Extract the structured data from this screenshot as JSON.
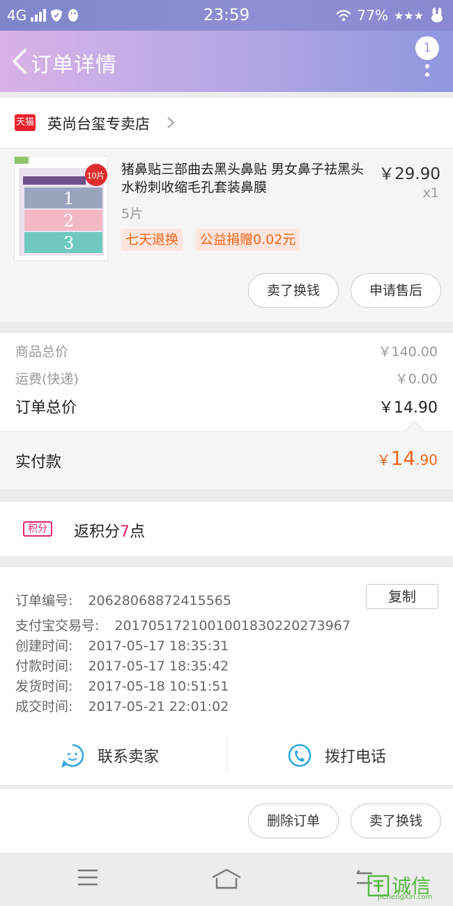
{
  "status_bar": {
    "network": "4G",
    "time": "23:59",
    "battery": "77%"
  },
  "header": {
    "title": "订单详情",
    "badge": "1"
  },
  "shop": {
    "platform_badge": "天猫",
    "name": "英尚台玺专卖店"
  },
  "product": {
    "name": "猪鼻贴三部曲去黑头鼻贴 男女鼻子祛黑头水粉刺收缩毛孔套装鼻膜",
    "price": "￥29.90",
    "quantity": "x1",
    "spec": "5片",
    "tags": [
      "七天退换",
      "公益捐赠0.02元"
    ],
    "thumb": {
      "badge": "10片",
      "steps": [
        "1",
        "2",
        "3"
      ]
    },
    "buttons": [
      "卖了换钱",
      "申请售后"
    ]
  },
  "summary": {
    "goods_total_label": "商品总价",
    "goods_total": "￥140.00",
    "shipping_label": "运费(快递)",
    "shipping": "￥0.00",
    "order_total_label": "订单总价",
    "order_total": "￥14.90",
    "paid_label": "实付款",
    "paid_currency": "￥",
    "paid_int": "14",
    "paid_dec": ".90"
  },
  "points": {
    "icon_label": "积分",
    "text_before": "返积分",
    "num": "7",
    "text_after": "点"
  },
  "order_info": {
    "order_no_label": "订单编号:",
    "order_no": "20628068872415565",
    "copy_label": "复制",
    "alipay_label": "支付宝交易号:",
    "alipay_no": "2017051721001001830220273967",
    "created_label": "创建时间:",
    "created": "2017-05-17 18:35:31",
    "paid_label": "付款时间:",
    "paid": "2017-05-17 18:35:42",
    "shipped_label": "发货时间:",
    "shipped": "2017-05-18 10:51:51",
    "closed_label": "成交时间:",
    "closed": "2017-05-21 22:01:02"
  },
  "contact": {
    "seller_label": "联系卖家",
    "call_label": "拨打电话"
  },
  "actions": {
    "delete_label": "删除订单",
    "sell_label": "卖了换钱"
  },
  "watermark": {
    "text": "诚信",
    "sub": "JiChengXin.com"
  },
  "colors": {
    "accent_orange": "#f0651b",
    "points_pink": "#e3236b",
    "icon_blue": "#2ea7e0",
    "tmall_red": "#e8202c"
  }
}
